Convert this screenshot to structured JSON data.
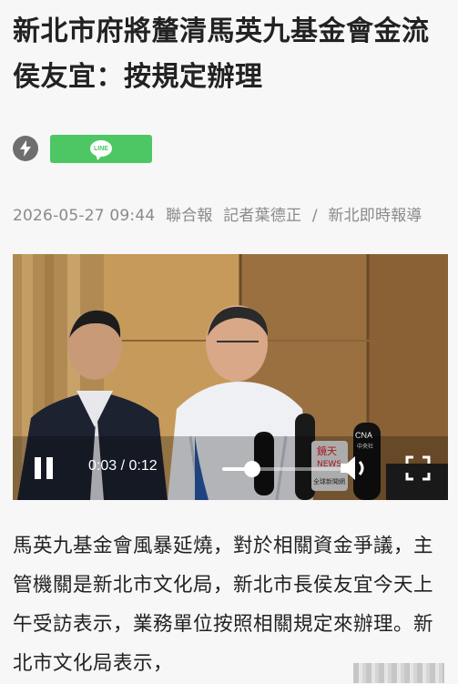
{
  "article": {
    "headline": "新北市府將釐清馬英九基金會金流 侯友宜：按規定辦理",
    "datetime": "2026-05-27 09:44",
    "source": "聯合報",
    "reporter": "記者葉德正",
    "separator": "/",
    "section": "新北即時報導",
    "body": "馬英九基金會風暴延燒，對於相關資金爭議，主管機關是新北市文化局，新北市長侯友宜今天上午受訪表示，業務單位按照相關規定來辦理。新北市文化局表示，"
  },
  "share": {
    "flash_icon": "lightning-bolt-icon",
    "line_label": "LINE",
    "line_color": "#4cc764"
  },
  "video": {
    "current_time": "0:03",
    "time_separator": " / ",
    "duration": "0:12",
    "progress_fraction": 0.25,
    "mic_label_1": "鏡天",
    "mic_label_2": "NEWS",
    "mic_label_3": "全球新聞網",
    "mic_label_4": "CNA",
    "mic_label_5": "中央社",
    "icons": [
      "pause-icon",
      "volume-icon",
      "fullscreen-icon"
    ]
  }
}
